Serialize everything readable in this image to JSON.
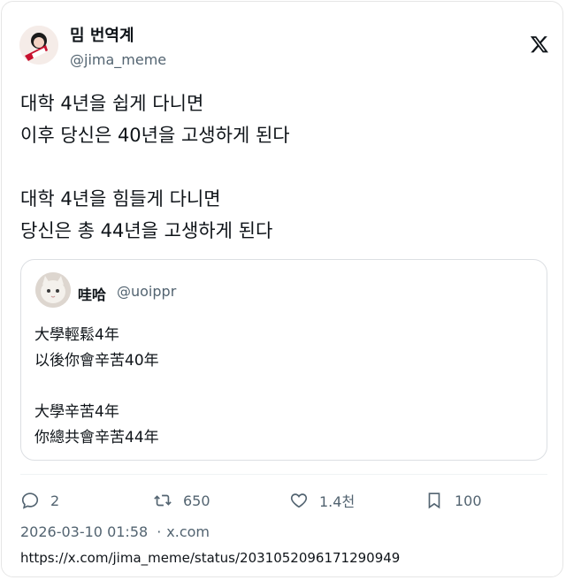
{
  "author": {
    "name": "밈 번역계",
    "handle": "@jima_meme"
  },
  "tweet_lines": [
    "대학 4년을 쉽게 다니면",
    "이후 당신은 40년을 고생하게 된다",
    "",
    "대학 4년을 힘들게 다니면",
    "당신은 총 44년을 고생하게 된다"
  ],
  "quote": {
    "name": "哇哈",
    "handle": "@uoippr",
    "lines": [
      "大學輕鬆4年",
      "以後你會辛苦40年",
      "",
      "大學辛苦4年",
      "你總共會辛苦44年"
    ]
  },
  "actions": {
    "replies": "2",
    "retweets": "650",
    "likes": "1.4천",
    "bookmarks": "100"
  },
  "meta": {
    "datetime": "2026-03-10 01:58",
    "separator": "·",
    "source": "x.com"
  },
  "url": "https://x.com/jima_meme/status/2031052096171290949",
  "icons": [
    "x-logo-icon",
    "reply-icon",
    "retweet-icon",
    "like-icon",
    "bookmark-icon"
  ],
  "colors": {
    "text": "#0f1419",
    "secondary": "#536471",
    "border": "#e6e6e6"
  }
}
